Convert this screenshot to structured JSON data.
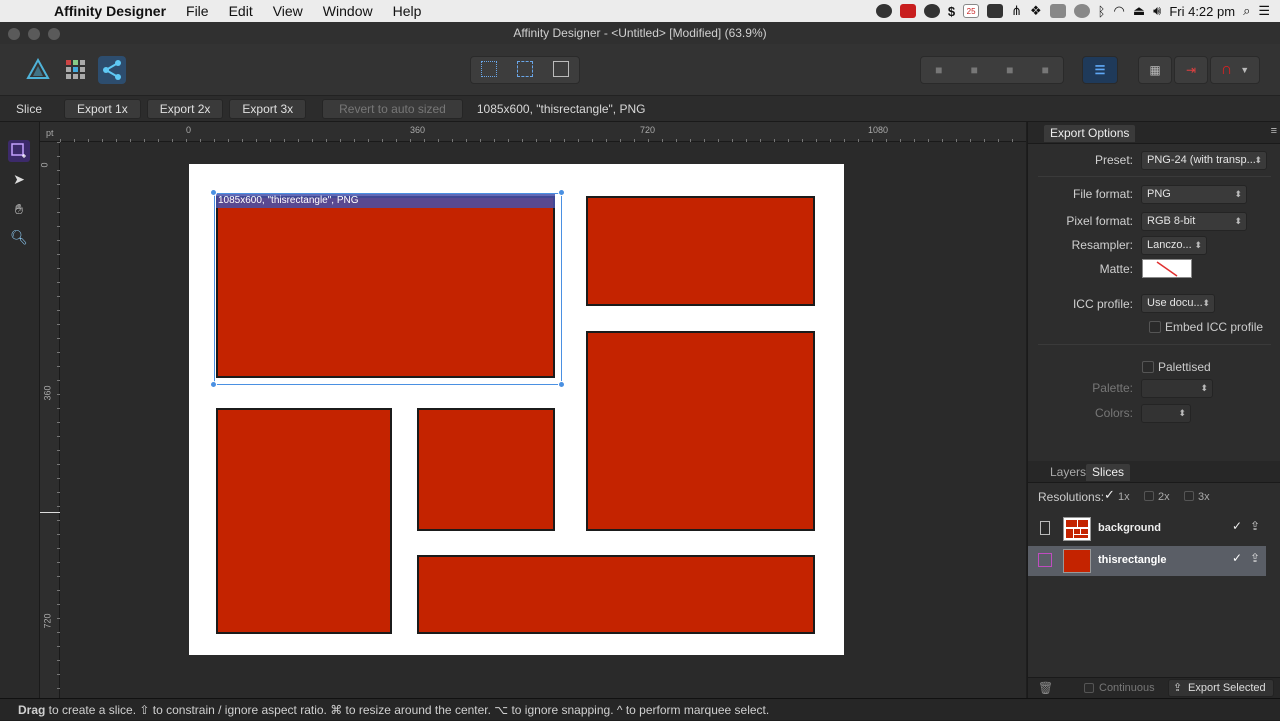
{
  "menubar": {
    "app_name": "Affinity Designer",
    "items": [
      "File",
      "Edit",
      "View",
      "Window",
      "Help"
    ],
    "clock": "Fri 4:22 pm",
    "calendar_day": "25"
  },
  "window": {
    "title": "Affinity Designer - <Untitled> [Modified] (63.9%)"
  },
  "contextbar": {
    "tool_name": "Slice",
    "export_1x": "Export 1x",
    "export_2x": "Export 2x",
    "export_3x": "Export 3x",
    "revert": "Revert to auto sized",
    "info": "1085x600, \"thisrectangle\", PNG"
  },
  "rulers": {
    "unit": "pt",
    "h_ticks": [
      "0",
      "360",
      "720",
      "1080"
    ],
    "v_ticks": [
      "0",
      "360",
      "720"
    ]
  },
  "canvas": {
    "slice_label": "1085x600, \"thisrectangle\", PNG"
  },
  "export_options": {
    "panel_title": "Export Options",
    "preset_label": "Preset:",
    "preset_value": "PNG-24 (with transp...",
    "file_format_label": "File format:",
    "file_format_value": "PNG",
    "pixel_format_label": "Pixel format:",
    "pixel_format_value": "RGB 8-bit",
    "resampler_label": "Resampler:",
    "resampler_value": "Lanczo...",
    "matte_label": "Matte:",
    "icc_label": "ICC profile:",
    "icc_value": "Use docu...",
    "embed_icc": "Embed ICC profile",
    "palettised": "Palettised",
    "palette_label": "Palette:",
    "colors_label": "Colors:"
  },
  "slices_panel": {
    "tab_layers": "Layers",
    "tab_slices": "Slices",
    "resolutions_label": "Resolutions:",
    "res_1x": "1x",
    "res_2x": "2x",
    "res_3x": "3x",
    "rows": [
      {
        "name": "background",
        "checked": true
      },
      {
        "name": "thisrectangle",
        "checked": true
      }
    ],
    "continuous": "Continuous",
    "export_selected": "Export Selected"
  },
  "statusbar": {
    "drag": "Drag",
    "hint": " to create a slice. ⇧ to constrain / ignore aspect ratio. ⌘ to resize around the center. ⌥ to ignore snapping. ^ to perform marquee select."
  },
  "colors": {
    "rect_fill": "#c42300",
    "selection": "#4a90e2",
    "slice_tool": "#c5a2ff"
  }
}
